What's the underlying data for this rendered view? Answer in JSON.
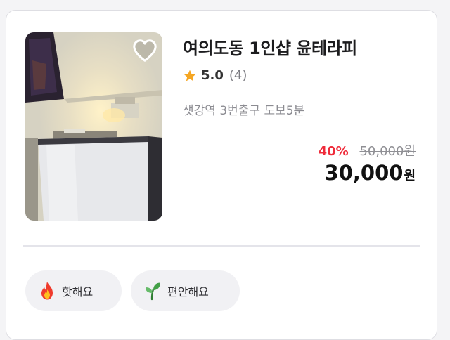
{
  "shop": {
    "name": "여의도동 1인샵 윤테라피",
    "rating": "5.0",
    "review_count": "(4)",
    "location": "샛강역 3번출구 도보5분",
    "liked": false
  },
  "price": {
    "discount": "40%",
    "original": "50,000원",
    "final_amount": "30,000",
    "currency": "원"
  },
  "tags": [
    {
      "label": "핫해요",
      "icon": "fire-icon"
    },
    {
      "label": "편안해요",
      "icon": "sprout-icon"
    }
  ],
  "colors": {
    "discount": "#ef2b3a",
    "star": "#f5a623",
    "tag_bg": "#f1f1f4"
  }
}
